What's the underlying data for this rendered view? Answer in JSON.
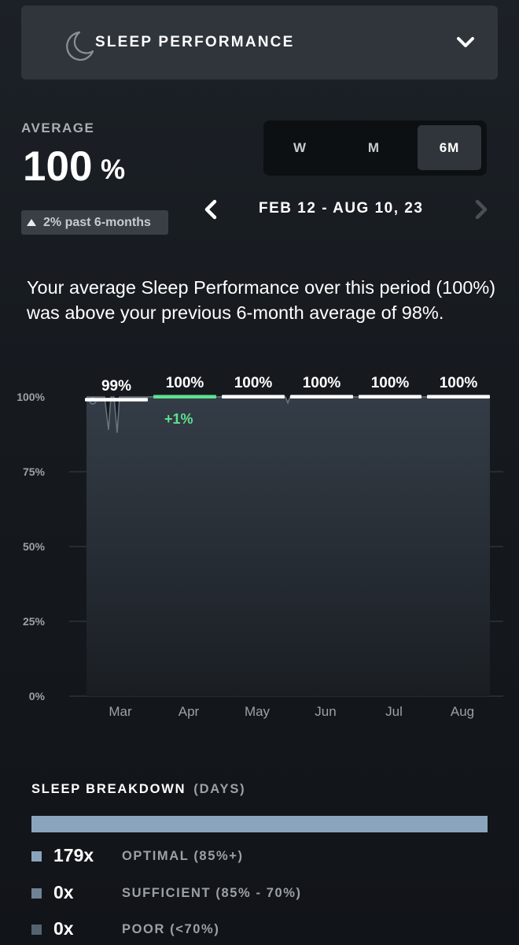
{
  "header": {
    "title": "SLEEP PERFORMANCE",
    "moon_icon": "moon-icon",
    "dropdown_icon": "chevron-down-icon"
  },
  "average": {
    "label": "AVERAGE",
    "value": "100",
    "unit": "%",
    "delta_text": "2% past 6-months",
    "delta_icon": "triangle-up-icon"
  },
  "range_tabs": [
    {
      "label": "W",
      "active": false
    },
    {
      "label": "M",
      "active": false
    },
    {
      "label": "6M",
      "active": true
    }
  ],
  "date_nav": {
    "range": "FEB 12 - AUG 10, 23",
    "prev_icon": "chevron-left-icon",
    "next_icon": "chevron-right-icon"
  },
  "summary": "Your average Sleep Performance over this period (100%) was above your previous 6-month average of 98%.",
  "chart_data": {
    "type": "area",
    "title": "",
    "xlabel": "",
    "ylabel": "",
    "y_ticks": [
      "100%",
      "75%",
      "50%",
      "25%",
      "0%"
    ],
    "ylim": [
      0,
      100
    ],
    "categories": [
      "Mar",
      "Apr",
      "May",
      "Jun",
      "Jul",
      "Aug"
    ],
    "monthly_average_labels": [
      "99%",
      "100%",
      "100%",
      "100%",
      "100%",
      "100%"
    ],
    "monthly_averages": [
      99,
      100,
      100,
      100,
      100,
      100
    ],
    "change_annotation": {
      "category": "Apr",
      "text": "+1%"
    },
    "daily_series_dips": [
      {
        "category": "Mar",
        "value": 89
      },
      {
        "category": "Mar",
        "value": 88
      },
      {
        "category": "Jun",
        "value": 98
      }
    ],
    "colors": {
      "highlight": "#5fe08f",
      "average_line": "#ffffff",
      "area": "#343d47",
      "grid": "#3a4047"
    }
  },
  "breakdown": {
    "title": "SLEEP BREAKDOWN",
    "unit": "(DAYS)",
    "bar_color": "#8aa4bd",
    "items": [
      {
        "count": "179x",
        "label": "OPTIMAL (85%+)",
        "color": "#8aa4bd"
      },
      {
        "count": "0x",
        "label": "SUFFICIENT (85% - 70%)",
        "color": "#6f8396"
      },
      {
        "count": "0x",
        "label": "POOR (<70%)",
        "color": "#56636f"
      }
    ]
  }
}
